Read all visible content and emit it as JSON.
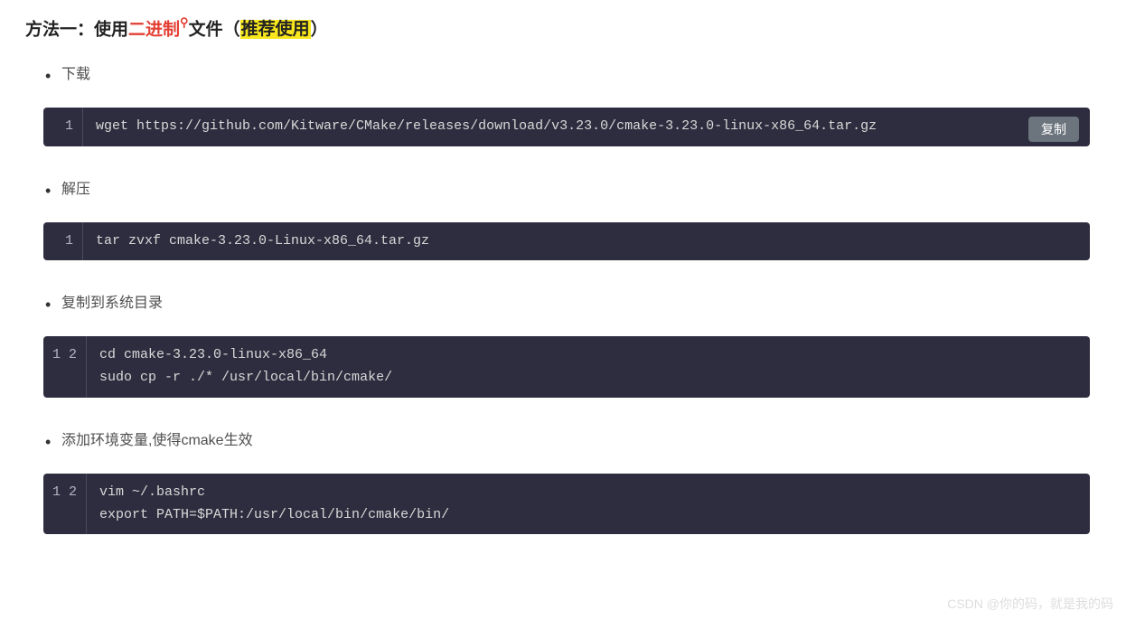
{
  "heading": {
    "part1": "方法一：使用",
    "linkText": "二进制",
    "part2": "文件（",
    "highlight": "推荐使用",
    "part3": "）"
  },
  "sections": [
    {
      "bullet": "下载",
      "hasCopy": true,
      "copyLabel": "复制",
      "lines": [
        "1"
      ],
      "code": "wget https://github.com/Kitware/CMake/releases/download/v3.23.0/cmake-3.23.0-linux-x86_64.tar.gz"
    },
    {
      "bullet": "解压",
      "hasCopy": false,
      "lines": [
        "1"
      ],
      "code": "tar zvxf cmake-3.23.0-Linux-x86_64.tar.gz"
    },
    {
      "bullet": "复制到系统目录",
      "hasCopy": false,
      "lines": [
        "1",
        "2"
      ],
      "code": "cd cmake-3.23.0-linux-x86_64\nsudo cp -r ./* /usr/local/bin/cmake/"
    },
    {
      "bullet": "添加环境变量,使得cmake生效",
      "hasCopy": false,
      "lines": [
        "1",
        "2"
      ],
      "code": "vim ~/.bashrc\nexport PATH=$PATH:/usr/local/bin/cmake/bin/"
    }
  ],
  "watermark": "CSDN @你的码，就是我的码"
}
